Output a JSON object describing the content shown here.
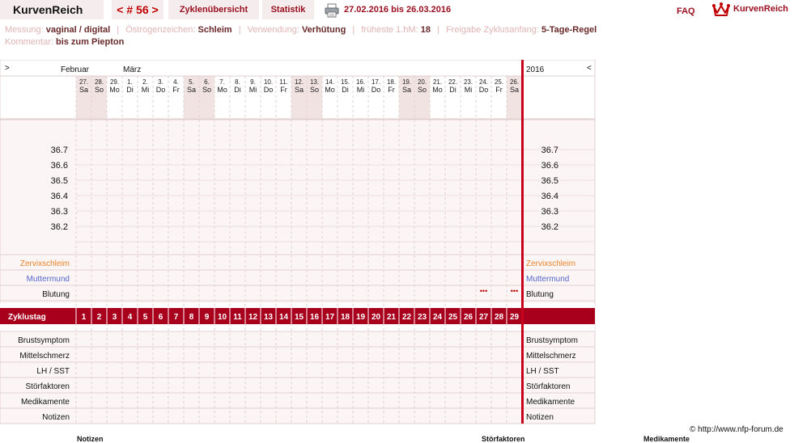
{
  "header": {
    "brand": "KurvenReich",
    "cycle_nav": "< # 56 >",
    "tab_overview": "Zyklenübersicht",
    "tab_stats": "Statistik",
    "date_range": "27.02.2016 bis 26.03.2016",
    "faq": "FAQ",
    "logo_text": "KurvenReich"
  },
  "info": {
    "measure_label": "Messung:",
    "measure_value": "vaginal / digital",
    "estrogen_label": "Östrogenzeichen:",
    "estrogen_value": "Schleim",
    "usage_label": "Verwendung:",
    "usage_value": "Verhütung",
    "earliest_label": "früheste 1.hM:",
    "earliest_value": "18",
    "release_label": "Freigabe Zyklusanfang:",
    "release_value": "5-Tage-Regel",
    "comment_label": "Kommentar:",
    "comment_value": "bis zum Piepton"
  },
  "chart": {
    "nav_left": ">",
    "nav_right": "<",
    "year": "2016",
    "months": [
      "Februar",
      "März"
    ],
    "dates": [
      "27.",
      "28.",
      "29.",
      "1.",
      "2.",
      "3.",
      "4.",
      "5.",
      "6.",
      "7.",
      "8.",
      "9.",
      "10.",
      "11.",
      "12.",
      "13.",
      "14.",
      "15.",
      "16.",
      "17.",
      "18.",
      "19.",
      "20.",
      "21.",
      "22.",
      "23.",
      "24.",
      "25.",
      "26."
    ],
    "weekdays": [
      "Sa",
      "So",
      "Mo",
      "Di",
      "Mi",
      "Do",
      "Fr",
      "Sa",
      "So",
      "Mo",
      "Di",
      "Mi",
      "Do",
      "Fr",
      "Sa",
      "So",
      "Mo",
      "Di",
      "Mi",
      "Do",
      "Fr",
      "Sa",
      "So",
      "Mo",
      "Di",
      "Mi",
      "Do",
      "Fr",
      "Sa"
    ],
    "weekend_days": [
      0,
      1,
      7,
      8,
      14,
      15,
      21,
      22,
      28
    ],
    "temp_labels": [
      "36.7",
      "36.6",
      "36.5",
      "36.4",
      "36.3",
      "36.2"
    ],
    "cycle_day_label": "Zyklustag",
    "cycle_days": [
      "1",
      "2",
      "3",
      "4",
      "5",
      "6",
      "7",
      "8",
      "9",
      "10",
      "11",
      "12",
      "13",
      "14",
      "15",
      "16",
      "17",
      "18",
      "19",
      "20",
      "21",
      "22",
      "23",
      "24",
      "25",
      "26",
      "27",
      "28",
      "29"
    ],
    "bleeding_marks": "•••",
    "bleeding_days": [
      26,
      28
    ],
    "rows_top": [
      {
        "label": "Zervixschleim",
        "color": "#e8842a"
      },
      {
        "label": "Muttermund",
        "color": "#5566cc"
      },
      {
        "label": "Blutung",
        "color": "#111111"
      }
    ],
    "rows_bottom": [
      {
        "label": "Brustsymptom",
        "color": "#111111"
      },
      {
        "label": "Mittelschmerz",
        "color": "#111111"
      },
      {
        "label": "LH / SST",
        "color": "#111111"
      },
      {
        "label": "Störfaktoren",
        "color": "#111111"
      },
      {
        "label": "Medikamente",
        "color": "#111111"
      },
      {
        "label": "Notizen",
        "color": "#111111"
      }
    ]
  },
  "footer": {
    "copyright": "© http://www.nfp-forum.de",
    "cut_labels": [
      "Notizen",
      "Störfaktoren",
      "Medikamente"
    ]
  }
}
